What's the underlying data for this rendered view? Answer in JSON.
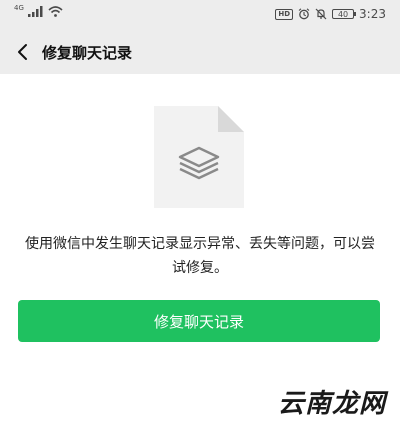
{
  "status_bar": {
    "signal_label": "4G",
    "hd_badge": "HD",
    "battery_level": "40",
    "time": "3:23",
    "icons": [
      "signal-icon",
      "wifi-icon",
      "alarm-icon",
      "mute-icon",
      "battery-icon"
    ]
  },
  "nav": {
    "back_icon": "chevron-left-icon",
    "title": "修复聊天记录"
  },
  "main": {
    "illustration_icon": "document-layers-icon",
    "description": "使用微信中发生聊天记录显示异常、丢失等问题，可以尝试修复。",
    "repair_button_label": "修复聊天记录"
  },
  "watermark": {
    "text": "云南龙网"
  },
  "colors": {
    "background": "#ededed",
    "content_background": "#ffffff",
    "accent_green": "#1fc160",
    "doc_gray": "#f2f2f2",
    "doc_fold": "#d9d9d9",
    "icon_gray": "#8a8a8a"
  }
}
